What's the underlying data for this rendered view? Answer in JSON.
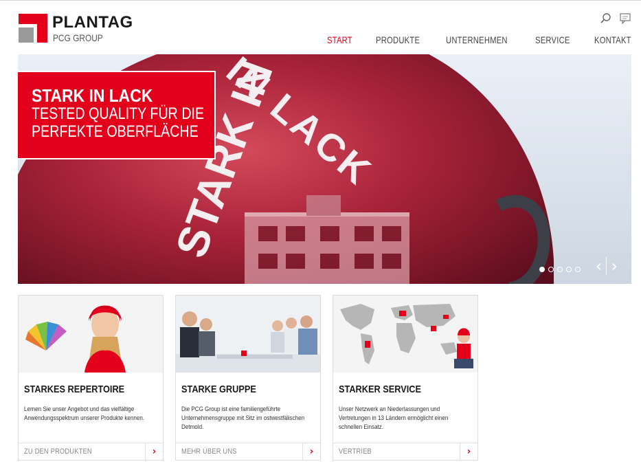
{
  "brand": {
    "name": "PLANTAG",
    "sub": "PCG GROUP"
  },
  "nav": [
    {
      "label": "START",
      "active": true
    },
    {
      "label": "PRODUKTE"
    },
    {
      "label": "UNTERNEHMEN"
    },
    {
      "label": "SERVICE"
    },
    {
      "label": "KONTAKT"
    }
  ],
  "utility": {
    "search_icon": "search-icon",
    "contact_icon": "chat-icon"
  },
  "hero": {
    "title": "STARK IN LACK",
    "subtitle_line1": "TESTED QUALITY FÜR DIE",
    "subtitle_line2": "PERFEKTE OBERFLÄCHE",
    "helmet_text": "STARK IN LACK",
    "slides": 5,
    "current_slide": 1
  },
  "cards": [
    {
      "title": "STARKES REPERTOIRE",
      "text": "Lernen Sie unser Angebot und das vielfältige Anwendungsspektrum unserer Produkte kennen.",
      "link": "ZU DEN PRODUKTEN"
    },
    {
      "title": "STARKE GRUPPE",
      "text": "Die PCG Group ist eine familiengeführte Unternehmensgruppe mit Sitz im ostwestfälischen Detmold.",
      "link": "MEHR ÜBER UNS"
    },
    {
      "title": "STARKER SERVICE",
      "text": "Unser Netzwerk an Niederlassungen und Vertretungen in 13 Ländern ermöglicht einen schnellen Einsatz.",
      "link": "VERTRIEB"
    }
  ],
  "colors": {
    "accent": "#e3001b",
    "grey": "#9a9a9a"
  }
}
